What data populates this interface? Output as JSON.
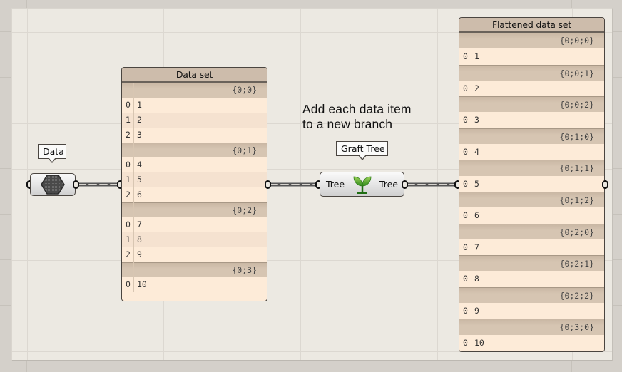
{
  "canvas": {
    "background_color": "#ece9e2",
    "outer_color": "#d4d0ca",
    "panel_fill": "#fdebd8",
    "panel_header": "#cdbcab",
    "branch_row_color": "#d6c5b2"
  },
  "annotation": {
    "line1": "Add each data item",
    "line2": "to a new branch"
  },
  "data_param": {
    "tooltip": "Data",
    "icon": "hexagon-icon"
  },
  "graft_component": {
    "tooltip": "Graft Tree",
    "input_label": "Tree",
    "output_label": "Tree",
    "icon": "sprout-icon"
  },
  "data_set_panel": {
    "title": "Data set",
    "branches": [
      {
        "path": "{0;0}",
        "items": [
          {
            "index": "0",
            "value": "1"
          },
          {
            "index": "1",
            "value": "2"
          },
          {
            "index": "2",
            "value": "3"
          }
        ]
      },
      {
        "path": "{0;1}",
        "items": [
          {
            "index": "0",
            "value": "4"
          },
          {
            "index": "1",
            "value": "5"
          },
          {
            "index": "2",
            "value": "6"
          }
        ]
      },
      {
        "path": "{0;2}",
        "items": [
          {
            "index": "0",
            "value": "7"
          },
          {
            "index": "1",
            "value": "8"
          },
          {
            "index": "2",
            "value": "9"
          }
        ]
      },
      {
        "path": "{0;3}",
        "items": [
          {
            "index": "0",
            "value": "10"
          }
        ]
      }
    ]
  },
  "flattened_panel": {
    "title": "Flattened data set",
    "branches": [
      {
        "path": "{0;0;0}",
        "items": [
          {
            "index": "0",
            "value": "1"
          }
        ]
      },
      {
        "path": "{0;0;1}",
        "items": [
          {
            "index": "0",
            "value": "2"
          }
        ]
      },
      {
        "path": "{0;0;2}",
        "items": [
          {
            "index": "0",
            "value": "3"
          }
        ]
      },
      {
        "path": "{0;1;0}",
        "items": [
          {
            "index": "0",
            "value": "4"
          }
        ]
      },
      {
        "path": "{0;1;1}",
        "items": [
          {
            "index": "0",
            "value": "5"
          }
        ]
      },
      {
        "path": "{0;1;2}",
        "items": [
          {
            "index": "0",
            "value": "6"
          }
        ]
      },
      {
        "path": "{0;2;0}",
        "items": [
          {
            "index": "0",
            "value": "7"
          }
        ]
      },
      {
        "path": "{0;2;1}",
        "items": [
          {
            "index": "0",
            "value": "8"
          }
        ]
      },
      {
        "path": "{0;2;2}",
        "items": [
          {
            "index": "0",
            "value": "9"
          }
        ]
      },
      {
        "path": "{0;3;0}",
        "items": [
          {
            "index": "0",
            "value": "10"
          }
        ]
      }
    ]
  }
}
